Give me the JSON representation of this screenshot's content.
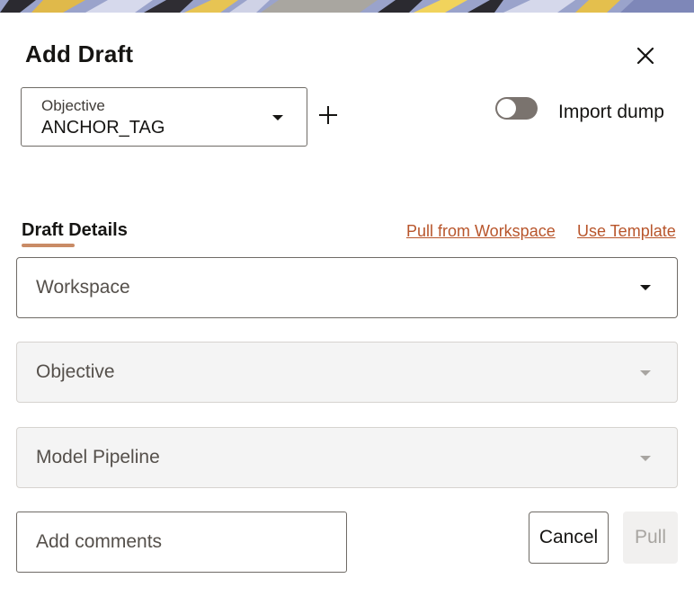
{
  "dialog": {
    "title": "Add Draft",
    "close_icon": "close-icon"
  },
  "objective_select": {
    "label": "Objective",
    "value": "ANCHOR_TAG",
    "add_icon": "plus-icon"
  },
  "import_toggle": {
    "label": "Import dump",
    "checked": false
  },
  "tabs": [
    {
      "label": "Draft Details",
      "selected": true
    }
  ],
  "links": {
    "pull_from_workspace": "Pull from Workspace",
    "use_template": "Use Template"
  },
  "fields": {
    "workspace": {
      "placeholder": "Workspace",
      "disabled": false
    },
    "objective": {
      "placeholder": "Objective",
      "disabled": true
    },
    "model_pipeline": {
      "placeholder": "Model Pipeline",
      "disabled": true
    }
  },
  "comments": {
    "placeholder": "Add comments"
  },
  "buttons": {
    "cancel": "Cancel",
    "pull": "Pull"
  },
  "colors": {
    "accent_link": "#b8552b",
    "tab_underline": "#c98b66",
    "toggle_off": "#7a736e",
    "disabled_bg": "#f4f4f4"
  }
}
